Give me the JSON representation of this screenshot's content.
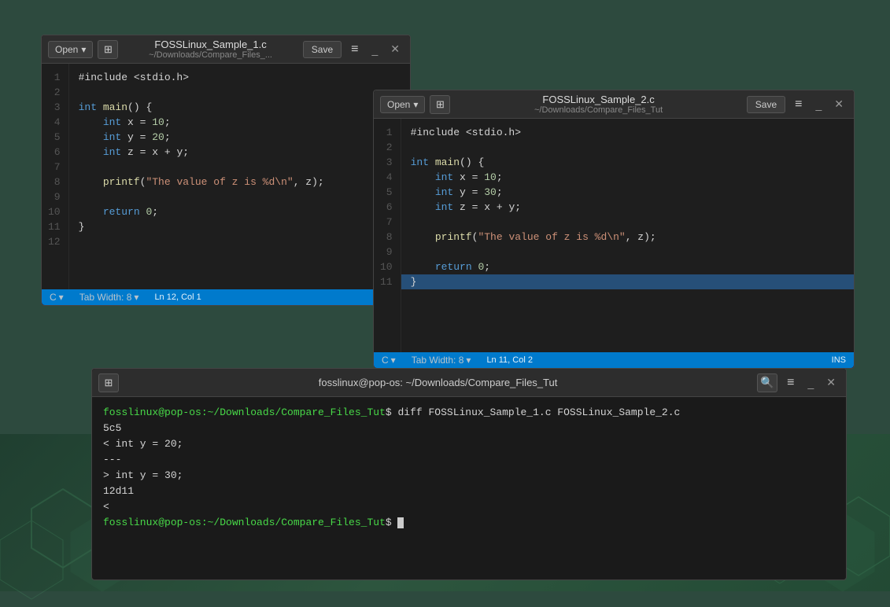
{
  "window1": {
    "title": "FOSSLinux_Sample_1.c",
    "subtitle": "~/Downloads/Compare_Files_...",
    "open_label": "Open",
    "save_label": "Save",
    "language": "C",
    "tab_width": "Tab Width: 8",
    "cursor_pos": "Ln 12, Col 1",
    "lines": [
      {
        "num": "1",
        "code": "#include <stdio.h>",
        "type": "plain"
      },
      {
        "num": "2",
        "code": "",
        "type": "plain"
      },
      {
        "num": "3",
        "code": "int main() {",
        "type": "plain"
      },
      {
        "num": "4",
        "code": "    int x = 10;",
        "type": "plain"
      },
      {
        "num": "5",
        "code": "    int y = 20;",
        "type": "plain"
      },
      {
        "num": "6",
        "code": "    int z = x + y;",
        "type": "plain"
      },
      {
        "num": "7",
        "code": "",
        "type": "plain"
      },
      {
        "num": "8",
        "code": "    printf(\"The value of z is %d\\n\", z);",
        "type": "plain"
      },
      {
        "num": "9",
        "code": "",
        "type": "plain"
      },
      {
        "num": "10",
        "code": "    return 0;",
        "type": "plain"
      },
      {
        "num": "11",
        "code": "}",
        "type": "plain"
      },
      {
        "num": "12",
        "code": "",
        "type": "plain"
      }
    ]
  },
  "window2": {
    "title": "FOSSLinux_Sample_2.c",
    "subtitle": "~/Downloads/Compare_Files_Tut",
    "open_label": "Open",
    "save_label": "Save",
    "language": "C",
    "tab_width": "Tab Width: 8",
    "cursor_pos": "Ln 11, Col 2",
    "ins_label": "INS",
    "lines": [
      {
        "num": "1",
        "code": "#include <stdio.h>",
        "type": "plain"
      },
      {
        "num": "2",
        "code": "",
        "type": "plain"
      },
      {
        "num": "3",
        "code": "int main() {",
        "type": "plain"
      },
      {
        "num": "4",
        "code": "    int x = 10;",
        "type": "plain"
      },
      {
        "num": "5",
        "code": "    int y = 30;",
        "type": "plain"
      },
      {
        "num": "6",
        "code": "    int z = x + y;",
        "type": "plain"
      },
      {
        "num": "7",
        "code": "",
        "type": "plain"
      },
      {
        "num": "8",
        "code": "    printf(\"The value of z is %d\\n\", z);",
        "type": "plain"
      },
      {
        "num": "9",
        "code": "",
        "type": "plain"
      },
      {
        "num": "10",
        "code": "    return 0;",
        "type": "plain"
      },
      {
        "num": "11",
        "code": "}",
        "type": "highlighted"
      }
    ]
  },
  "terminal": {
    "title": "fosslinux@pop-os: ~/Downloads/Compare_Files_Tut",
    "prompt1": "fosslinux@pop-os",
    "path1": ":~/Downloads/Compare_Files_Tut",
    "command": "$ diff FOSSLinux_Sample_1.c FOSSLinux_Sample_2.c",
    "output": [
      "5c5",
      "<      int y = 20;",
      "---",
      ">      int y = 30;",
      "12d11",
      "<"
    ],
    "prompt2": "fosslinux@pop-os",
    "path2": ":~/Downloads/Compare_Files_Tut"
  },
  "icons": {
    "open_arrow": "▾",
    "menu": "≡",
    "minimize": "_",
    "close": "✕",
    "search": "🔍",
    "add_file": "⊞"
  }
}
